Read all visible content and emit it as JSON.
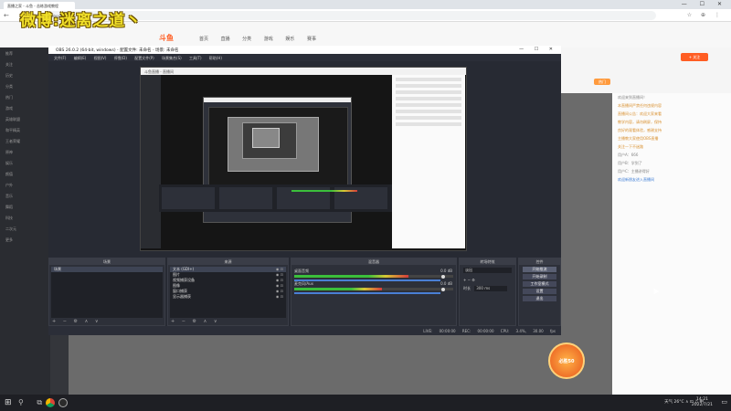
{
  "browser": {
    "tab_title": "直播之家 - 斗鱼 - 苦练游戏教程",
    "url": "douyu.com",
    "nav": "← → ⟳",
    "addr_icons": "☆ ⊕ ⋮",
    "win_controls": "— ☐ ✕"
  },
  "watermark": "微博:迷离之道丶",
  "site": {
    "logo": "斗鱼",
    "nav_items": "首页 直播 分类 游戏 娱乐 赛事",
    "follow_label": "+ 关注",
    "hot_badge": "热门",
    "badge_text": "必胜50",
    "left_items": [
      "推荐",
      "关注",
      "历史",
      "分类",
      "热门",
      "游戏",
      "英雄联盟",
      "和平精英",
      "王者荣耀",
      "原神",
      "娱乐",
      "颜值",
      "户外",
      "音乐",
      "舞蹈",
      "科技",
      "二次元",
      "更多"
    ],
    "chat_messages": [
      {
        "text": "欢迎来到直播间！",
        "hl": false
      },
      {
        "text": "本直播间严禁任何违规内容",
        "hl": true
      },
      {
        "text": "直播间公告：欢迎大家来看",
        "hl": true
      },
      {
        "text": "教学内容，请勿刷屏，保持",
        "hl": true
      },
      {
        "text": "良好的观看体验，感谢支持",
        "hl": true
      },
      {
        "text": "主播教大家使用OBS直播",
        "hl": true
      },
      {
        "text": "关注一下不迷路",
        "hl": true
      },
      {
        "text": "用户A：666",
        "hl": false
      },
      {
        "text": "用户B：学到了",
        "hl": false
      },
      {
        "text": "用户C：主播讲得好",
        "hl": false
      },
      {
        "text": "欢迎新朋友进入直播间",
        "ts": true
      }
    ],
    "chat_input": "发弹幕"
  },
  "obs": {
    "title": "OBS 26.0.2 (64-bit, windows) - 配置文件: 未命名 - 场景: 未命名",
    "menu": "文件(F) 编辑(E) 视图(V) 停靠(D) 配置文件(P) 场景集合(S) 工具(T) 帮助(H)",
    "nested_header": "斗鱼直播 - 直播间",
    "docks": {
      "scenes": {
        "title": "场景",
        "items": [
          "场景"
        ]
      },
      "sources": {
        "title": "来源",
        "items": [
          "文本 (GDI+)",
          "图片",
          "视频捕获设备",
          "图像",
          "窗口捕获",
          "显示器捕获"
        ]
      },
      "mixer": {
        "title": "混音器",
        "tracks": [
          {
            "name": "桌面音频",
            "db": "0.0 dB",
            "level": 0.72
          },
          {
            "name": "麦克风/Aux",
            "db": "0.0 dB",
            "level": 0.55
          }
        ]
      },
      "transitions": {
        "title": "转场特效",
        "selected": "淡出",
        "duration_label": "时长",
        "duration": "300 ms"
      },
      "controls": {
        "title": "控件",
        "buttons": [
          "开始推流",
          "开始录制",
          "工作室模式",
          "设置",
          "退出"
        ]
      }
    },
    "footer_icons": "+ − ⚙ ∧ ∨",
    "status": "LIVE: 00:00:00 REC: 00:00:00 CPU: 3.4%, 30.00 fps"
  },
  "taskbar": {
    "start": "⊞",
    "icons": "⚲ ⧉",
    "tray": "天气 26°C  ∧  ⊡  ♫  中",
    "time": "14:21",
    "date": "2022/7/21",
    "notif": "▭"
  }
}
